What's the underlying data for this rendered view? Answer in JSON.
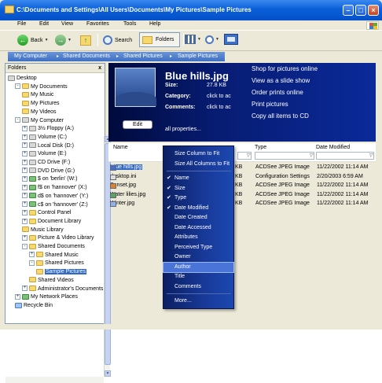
{
  "window": {
    "title": "C:\\Documents and Settings\\All Users\\Documents\\My Pictures\\Sample Pictures"
  },
  "menu": [
    "File",
    "Edit",
    "View",
    "Favorites",
    "Tools",
    "Help"
  ],
  "toolbar": {
    "back_label": "Back",
    "search_label": "Search",
    "folders_label": "Folders"
  },
  "address": [
    "My Computer",
    "Shared Documents",
    "Shared Pictures",
    "Sample Pictures"
  ],
  "folders_pane": {
    "title": "Folders",
    "close": "x",
    "tree": [
      {
        "label": "Desktop",
        "level": 0,
        "icon": "desktop"
      },
      {
        "label": "My Documents",
        "level": 1,
        "icon": "folder",
        "pm": "-"
      },
      {
        "label": "My Music",
        "level": 2,
        "icon": "folder"
      },
      {
        "label": "My Pictures",
        "level": 2,
        "icon": "folder"
      },
      {
        "label": "My Videos",
        "level": 2,
        "icon": "folder"
      },
      {
        "label": "My Computer",
        "level": 1,
        "icon": "computer",
        "pm": "-"
      },
      {
        "label": "3½ Floppy (A:)",
        "level": 2,
        "icon": "drive",
        "pm": "+"
      },
      {
        "label": "Volume (C:)",
        "level": 2,
        "icon": "drive",
        "pm": "+"
      },
      {
        "label": "Local Disk (D:)",
        "level": 2,
        "icon": "drive",
        "pm": "+"
      },
      {
        "label": "Volume (E:)",
        "level": 2,
        "icon": "drive",
        "pm": "+"
      },
      {
        "label": "CD Drive (F:)",
        "level": 2,
        "icon": "drive",
        "pm": "+"
      },
      {
        "label": "DVD Drive (G:)",
        "level": 2,
        "icon": "drive",
        "pm": "+"
      },
      {
        "label": "$ on 'berlin' (W:)",
        "level": 2,
        "icon": "net",
        "pm": "+"
      },
      {
        "label": "f$ on 'hannover' (X:)",
        "level": 2,
        "icon": "net",
        "pm": "+"
      },
      {
        "label": "d$ on 'hannover' (Y:)",
        "level": 2,
        "icon": "net",
        "pm": "+"
      },
      {
        "label": "c$ on 'hannover' (Z:)",
        "level": 2,
        "icon": "net",
        "pm": "+"
      },
      {
        "label": "Control Panel",
        "level": 2,
        "icon": "folder",
        "pm": "+"
      },
      {
        "label": "Document Library",
        "level": 2,
        "icon": "folder",
        "pm": "+"
      },
      {
        "label": "Music Library",
        "level": 2,
        "icon": "folder"
      },
      {
        "label": "Picture & Video Library",
        "level": 2,
        "icon": "folder",
        "pm": "+"
      },
      {
        "label": "Shared Documents",
        "level": 2,
        "icon": "folder",
        "pm": "-"
      },
      {
        "label": "Shared Music",
        "level": 3,
        "icon": "folder",
        "pm": "+"
      },
      {
        "label": "Shared Pictures",
        "level": 3,
        "icon": "folder",
        "pm": "-"
      },
      {
        "label": "Sample Pictures",
        "level": 4,
        "icon": "folder",
        "selected": true
      },
      {
        "label": "Shared Videos",
        "level": 3,
        "icon": "folder"
      },
      {
        "label": "Administrator's Documents",
        "level": 2,
        "icon": "folder",
        "pm": "+"
      },
      {
        "label": "My Network Places",
        "level": 1,
        "icon": "net",
        "pm": "+"
      },
      {
        "label": "Recycle Bin",
        "level": 1,
        "icon": "recycle"
      }
    ]
  },
  "preview": {
    "filename": "Blue hills.jpg",
    "size_label": "Size:",
    "size_value": "27.8 KB",
    "category_label": "Category:",
    "category_value": "click to ac",
    "comments_label": "Comments:",
    "comments_value": "click to ac",
    "edit_label": "Edit",
    "all_props": "all properties...",
    "actions": [
      "Shop for pictures online",
      "View as a slide show",
      "Order prints online",
      "Print pictures",
      "Copy all items to CD"
    ]
  },
  "columns": {
    "name": "Name",
    "type": "Type",
    "date": "Date Modified"
  },
  "files": [
    {
      "name": "Blue hills.jpg",
      "size": "KB",
      "type": "ACDSee JPEG Image",
      "date": "11/22/2002 11:14 AM",
      "selected": true
    },
    {
      "name": "desktop.ini",
      "size": "KB",
      "type": "Configuration Settings",
      "date": "2/20/2003 6:59 AM"
    },
    {
      "name": "Sunset.jpg",
      "size": "KB",
      "type": "ACDSee JPEG Image",
      "date": "11/22/2002 11:14 AM"
    },
    {
      "name": "Water lilies.jpg",
      "size": "KB",
      "type": "ACDSee JPEG Image",
      "date": "11/22/2002 11:14 AM"
    },
    {
      "name": "Winter.jpg",
      "size": "KB",
      "type": "ACDSee JPEG Image",
      "date": "11/22/2002 11:14 AM"
    }
  ],
  "context_menu": [
    {
      "label": "Size Column to Fit"
    },
    {
      "label": "Size All Columns to Fit"
    },
    {
      "sep": true
    },
    {
      "label": "Name",
      "checked": true
    },
    {
      "label": "Size",
      "checked": true
    },
    {
      "label": "Type",
      "checked": true
    },
    {
      "label": "Date Modified",
      "checked": true
    },
    {
      "label": "Date Created"
    },
    {
      "label": "Date Accessed"
    },
    {
      "label": "Attributes"
    },
    {
      "label": "Perceived Type"
    },
    {
      "label": "Owner"
    },
    {
      "label": "Author",
      "highlighted": true
    },
    {
      "label": "Title"
    },
    {
      "label": "Comments"
    },
    {
      "sep": true
    },
    {
      "label": "More..."
    }
  ]
}
